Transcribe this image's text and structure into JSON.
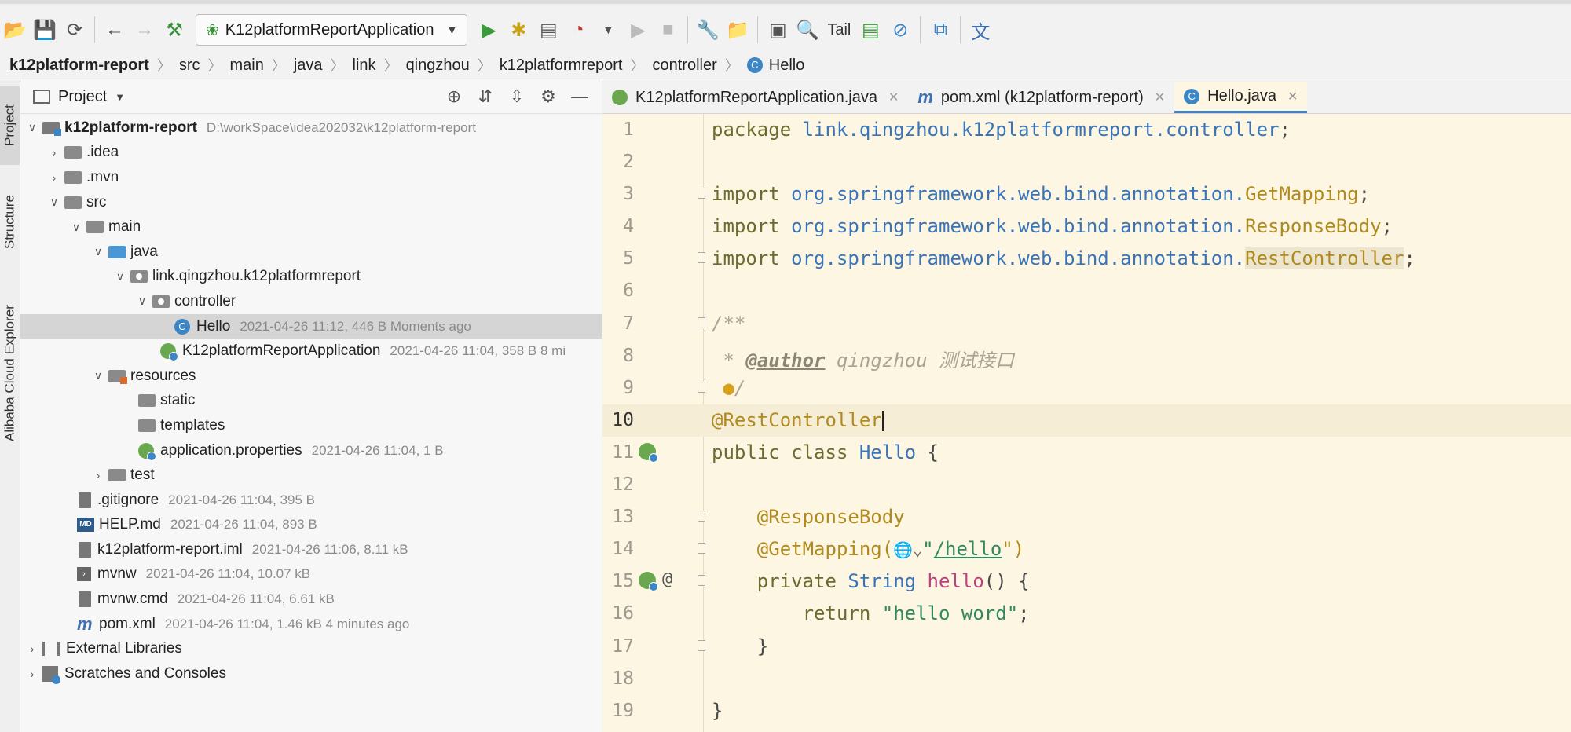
{
  "toolbar": {
    "run_config": "K12platformReportApplication",
    "tail_label": "Tail"
  },
  "breadcrumb": [
    "k12platform-report",
    "src",
    "main",
    "java",
    "link",
    "qingzhou",
    "k12platformreport",
    "controller",
    "Hello"
  ],
  "side_tabs": {
    "project": "Project",
    "structure": "Structure",
    "alibaba": "Alibaba Cloud Explorer"
  },
  "project_panel": {
    "title": "Project",
    "tree": [
      {
        "name": "k12platform-report",
        "meta": "D:\\workSpace\\idea202032\\k12platform-report"
      },
      {
        "name": ".idea",
        "meta": ""
      },
      {
        "name": ".mvn",
        "meta": ""
      },
      {
        "name": "src",
        "meta": ""
      },
      {
        "name": "main",
        "meta": ""
      },
      {
        "name": "java",
        "meta": ""
      },
      {
        "name": "link.qingzhou.k12platformreport",
        "meta": ""
      },
      {
        "name": "controller",
        "meta": ""
      },
      {
        "name": "Hello",
        "meta": "2021-04-26 11:12, 446 B Moments ago"
      },
      {
        "name": "K12platformReportApplication",
        "meta": "2021-04-26 11:04, 358 B 8 mi"
      },
      {
        "name": "resources",
        "meta": ""
      },
      {
        "name": "static",
        "meta": ""
      },
      {
        "name": "templates",
        "meta": ""
      },
      {
        "name": "application.properties",
        "meta": "2021-04-26 11:04, 1 B"
      },
      {
        "name": "test",
        "meta": ""
      },
      {
        "name": ".gitignore",
        "meta": "2021-04-26 11:04, 395 B"
      },
      {
        "name": "HELP.md",
        "meta": "2021-04-26 11:04, 893 B"
      },
      {
        "name": "k12platform-report.iml",
        "meta": "2021-04-26 11:06, 8.11 kB"
      },
      {
        "name": "mvnw",
        "meta": "2021-04-26 11:04, 10.07 kB"
      },
      {
        "name": "mvnw.cmd",
        "meta": "2021-04-26 11:04, 6.61 kB"
      },
      {
        "name": "pom.xml",
        "meta": "2021-04-26 11:04, 1.46 kB 4 minutes ago"
      },
      {
        "name": "External Libraries",
        "meta": ""
      },
      {
        "name": "Scratches and Consoles",
        "meta": ""
      }
    ],
    "md_badge": "MD"
  },
  "editor": {
    "tabs": [
      {
        "label": "K12platformReportApplication.java"
      },
      {
        "label": "pom.xml (k12platform-report)"
      },
      {
        "label": "Hello.java"
      }
    ],
    "class_badge": "C",
    "line_numbers": [
      "1",
      "2",
      "3",
      "4",
      "5",
      "6",
      "7",
      "8",
      "9",
      "10",
      "11",
      "12",
      "13",
      "14",
      "15",
      "16",
      "17",
      "18",
      "19"
    ],
    "code": {
      "l1_kw": "package ",
      "l1_pkg": "link.qingzhou.k12platformreport.controller",
      "l3_pkg": "org.springframework.web.bind.annotation.",
      "l3_cls": "GetMapping",
      "l4_cls": "ResponseBody",
      "l5_cls": "RestController",
      "import_kw": "import ",
      "semi": ";",
      "l7": "/**",
      "l8_star": " * ",
      "l8_tag": "@author",
      "l8_text": " qingzhou 测试接口",
      "l9": "/",
      "l10": "@RestController",
      "l11_kw": "public class ",
      "l11_name": "Hello",
      "l11_brace": " {",
      "l13": "@ResponseBody",
      "l14_ann": "@GetMapping(",
      "l14_url": "/hello",
      "l14_end": "\")",
      "l14_q": "\"",
      "l15_kw": "private ",
      "l15_type": "String ",
      "l15_fn": "hello",
      "l15_end": "() {",
      "l16_kw": "return ",
      "l16_str": "\"hello word\"",
      "l17": "}",
      "l19": "}"
    }
  }
}
